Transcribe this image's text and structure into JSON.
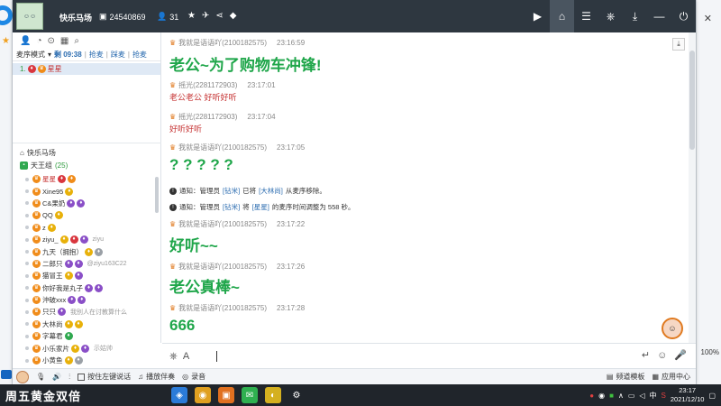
{
  "titlebar": {
    "room_name": "快乐马场",
    "room_id": "24540869",
    "online_count": "31",
    "icons": [
      "star-icon",
      "plane-icon",
      "share-icon",
      "shield-icon"
    ],
    "right_icons": [
      "video-icon",
      "home-icon",
      "list-icon",
      "gamepad-icon",
      "download-icon",
      "minimize-icon",
      "power-icon"
    ]
  },
  "left": {
    "tools": [
      "user-icon",
      "speedometer-icon",
      "location-icon",
      "grid-icon",
      "search-icon"
    ],
    "mic_mode": "麦序模式",
    "timer": "剩 09:38",
    "links": [
      "抢麦",
      "踩麦",
      "抢麦"
    ],
    "mic_user": {
      "num": "1.",
      "name": "星星"
    },
    "channel": "快乐马场",
    "room": "天王组",
    "room_count": "(25)",
    "users": [
      {
        "name": "星星",
        "extra": "",
        "red": true
      },
      {
        "name": "Xine95",
        "extra": "",
        "red": false
      },
      {
        "name": "C&果奶",
        "extra": "",
        "red": false
      },
      {
        "name": "QQ",
        "extra": "",
        "red": false
      },
      {
        "name": "z",
        "extra": "",
        "red": false
      },
      {
        "name": "ziyu_",
        "extra": "ziyu",
        "red": false
      },
      {
        "name": "九天（拥抱）",
        "extra": "",
        "red": false
      },
      {
        "name": "二郎只",
        "extra": "@ziyu163C22",
        "red": false
      },
      {
        "name": "猫冒王",
        "extra": "",
        "red": false
      },
      {
        "name": "你好我是丸子",
        "extra": "",
        "red": false
      },
      {
        "name": "沖破xxx",
        "extra": "",
        "red": false
      },
      {
        "name": "只只",
        "extra": "我别人在讨教算什么",
        "red": false
      },
      {
        "name": "大林尚",
        "extra": "",
        "red": false
      },
      {
        "name": "字幕君",
        "extra": "",
        "red": false
      },
      {
        "name": "小乐家片",
        "extra": "示姑帅",
        "red": false
      },
      {
        "name": "小黄鱼",
        "extra": "",
        "red": false
      }
    ]
  },
  "chat": {
    "messages": [
      {
        "type": "msg",
        "sender": "我就是语语吖(2100182575)",
        "time": "23:16:59",
        "text": "老公~为了购物车冲锋!",
        "style": "big"
      },
      {
        "type": "msg",
        "sender": "摇光(2281172903)",
        "time": "23:17:01",
        "text": "老公老公 好听好听",
        "style": "small"
      },
      {
        "type": "msg",
        "sender": "摇光(2281172903)",
        "time": "23:17:04",
        "text": "好听好听",
        "style": "small"
      },
      {
        "type": "msg",
        "sender": "我就是语语吖(2100182575)",
        "time": "23:17:05",
        "text": "? ? ? ? ?",
        "style": "big"
      }
    ],
    "notice1": {
      "prefix": "通知：管理员",
      "admin": "[钻米]",
      "mid": "已将",
      "target": "[大林尚]",
      "suffix": "从麦序移除。"
    },
    "notice2": {
      "prefix": "通知：管理员",
      "admin": "[钻米]",
      "mid": "将",
      "target": "[星星]",
      "suffix": "的麦序时间调整为 558 秒。"
    },
    "messages2": [
      {
        "sender": "我就是语语吖(2100182575)",
        "time": "23:17:22",
        "text": "好听~~"
      },
      {
        "sender": "我就是语语吖(2100182575)",
        "time": "23:17:26",
        "text": "老公真棒~"
      },
      {
        "sender": "我就是语语吖(2100182575)",
        "time": "23:17:28",
        "text": "666"
      }
    ]
  },
  "statusbar": {
    "items": [
      "按住左键说话",
      "播放伴奏",
      "录音"
    ],
    "right": [
      "频道模板",
      "应用中心"
    ],
    "percent": "100%"
  },
  "taskbar": {
    "search_text": "周五黄金双倍",
    "ime": "中",
    "time": "23:17",
    "date": "2021/12/10"
  }
}
